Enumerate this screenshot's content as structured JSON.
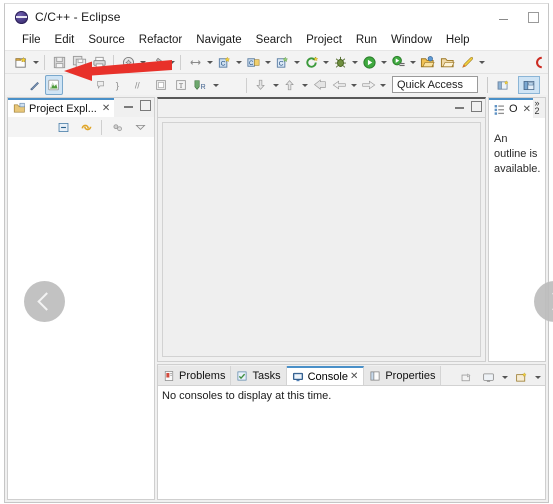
{
  "window": {
    "title": "C/C++ - Eclipse",
    "app_icon": "eclipse-icon",
    "minimize_label": "Minimize",
    "maximize_label": "Maximize"
  },
  "menu": {
    "items": [
      {
        "label": "File"
      },
      {
        "label": "Edit"
      },
      {
        "label": "Source"
      },
      {
        "label": "Refactor"
      },
      {
        "label": "Navigate"
      },
      {
        "label": "Search"
      },
      {
        "label": "Project"
      },
      {
        "label": "Run"
      },
      {
        "label": "Window"
      },
      {
        "label": "Help"
      }
    ]
  },
  "toolbar": {
    "quick_access_placeholder": "Quick Access",
    "row1": [
      {
        "name": "new-wizard-button",
        "icon": "new-file-icon",
        "dropdown": true
      },
      {
        "name": "separator-1",
        "icon": "separator"
      },
      {
        "name": "save-button",
        "icon": "save-icon"
      },
      {
        "name": "save-all-button",
        "icon": "save-all-icon"
      },
      {
        "name": "print-button",
        "icon": "print-icon"
      },
      {
        "name": "separator-2",
        "icon": "separator"
      },
      {
        "name": "build-all-button",
        "icon": "build-all-icon",
        "dropdown": true
      },
      {
        "name": "build-button",
        "icon": "hammer-icon",
        "dropdown": true
      },
      {
        "name": "separator-3",
        "icon": "separator"
      },
      {
        "name": "toggle-marker-button",
        "icon": "toggle-marker-icon",
        "dropdown": true
      },
      {
        "name": "new-c-project-button",
        "icon": "new-c-project-icon",
        "dropdown": true
      },
      {
        "name": "new-cpp-project-button",
        "icon": "new-cpp-class-icon",
        "dropdown": true
      },
      {
        "name": "new-c-class-button",
        "icon": "new-c-source-icon",
        "dropdown": true
      },
      {
        "name": "refresh-button",
        "icon": "refresh-icon",
        "dropdown": true
      },
      {
        "name": "debug-button",
        "icon": "debug-bug-icon",
        "dropdown": true
      },
      {
        "name": "run-button",
        "icon": "run-play-icon",
        "dropdown": true
      },
      {
        "name": "run-last-tool-button",
        "icon": "external-tools-icon",
        "dropdown": true
      },
      {
        "name": "open-type-button",
        "icon": "open-folder-yellow-icon"
      },
      {
        "name": "open-resource-button",
        "icon": "open-folder-icon"
      },
      {
        "name": "skip-breakpoints-button",
        "icon": "pencil-icon",
        "dropdown": true
      }
    ],
    "row2": [
      {
        "name": "toggle-comment-button",
        "icon": "pen-strike-icon"
      },
      {
        "name": "toggle-mark-occurrences-button",
        "icon": "green-marker-icon",
        "selected": true
      },
      {
        "name": "block-comment-button",
        "icon": "comment-block-icon"
      },
      {
        "name": "indent-button",
        "icon": "indent-icon"
      },
      {
        "name": "line-comment-button",
        "icon": "slash-comment-icon"
      },
      {
        "name": "show-source-button",
        "icon": "box-icon"
      },
      {
        "name": "show-outline-button",
        "icon": "t-box-icon"
      },
      {
        "name": "search-refs-button",
        "icon": "search-r-icon",
        "dropdown": true
      },
      {
        "name": "separator-4",
        "icon": "separator"
      },
      {
        "name": "next-annotation-button",
        "icon": "next-annotation-icon",
        "dropdown": true
      },
      {
        "name": "prev-annotation-button",
        "icon": "prev-annotation-icon",
        "dropdown": true
      },
      {
        "name": "last-edit-button",
        "icon": "last-edit-icon"
      },
      {
        "name": "back-button",
        "icon": "back-arrow-icon",
        "dropdown": true
      },
      {
        "name": "forward-button",
        "icon": "forward-arrow-icon",
        "dropdown": true
      }
    ],
    "perspectives": [
      {
        "name": "open-perspective-button",
        "icon": "open-perspective-icon",
        "active": false
      },
      {
        "name": "perspective-cpp-button",
        "icon": "cpp-perspective-icon",
        "active": true
      }
    ]
  },
  "project_explorer": {
    "tab_label": "Project Expl...",
    "tab_icon": "project-explorer-icon",
    "close_glyph": "✕",
    "toolbar": [
      {
        "name": "collapse-all-button",
        "icon": "collapse-all-icon"
      },
      {
        "name": "link-with-editor-button",
        "icon": "link-editor-icon"
      },
      {
        "name": "focus-on-active-task-button",
        "icon": "focus-task-icon"
      },
      {
        "name": "view-menu-button",
        "icon": "view-menu-icon"
      }
    ]
  },
  "editor": {
    "minimize_label": "Minimize",
    "maximize_label": "Maximize"
  },
  "outline": {
    "tab_label": "O",
    "tab_icon": "outline-icon",
    "close_glyph": "✕",
    "overflow_label": "»",
    "overflow_count": "2",
    "message_line1": "An outline is",
    "message_line2": "available."
  },
  "bottom_panel": {
    "tabs": [
      {
        "label": "Problems",
        "icon": "problems-icon",
        "active": false
      },
      {
        "label": "Tasks",
        "icon": "tasks-icon",
        "active": false
      },
      {
        "label": "Console",
        "icon": "console-icon",
        "active": true,
        "close_glyph": "✕"
      },
      {
        "label": "Properties",
        "icon": "properties-icon",
        "active": false
      }
    ],
    "controls": [
      {
        "name": "open-console-button",
        "icon": "open-console-icon"
      },
      {
        "name": "display-selected-console-button",
        "icon": "display-console-icon",
        "dropdown": true
      },
      {
        "name": "new-console-view-button",
        "icon": "new-console-icon",
        "dropdown": true
      }
    ],
    "console_message": "No consoles to display at this time."
  },
  "navigation": {
    "prev_label": "Previous",
    "next_label": "Next",
    "prev_icon": "chevron-left-icon",
    "next_icon": "chevron-right-icon"
  },
  "annotation": {
    "arrow_name": "red-pointer-arrow",
    "color": "#e8312a",
    "points_to": "toggle-mark-occurrences-button"
  },
  "colors": {
    "tab_accent": "#4a90c8",
    "toolbar_bg": "#f3f3f3",
    "selected_tool_bg": "#cfe4f5",
    "annotation_red": "#e8312a"
  }
}
